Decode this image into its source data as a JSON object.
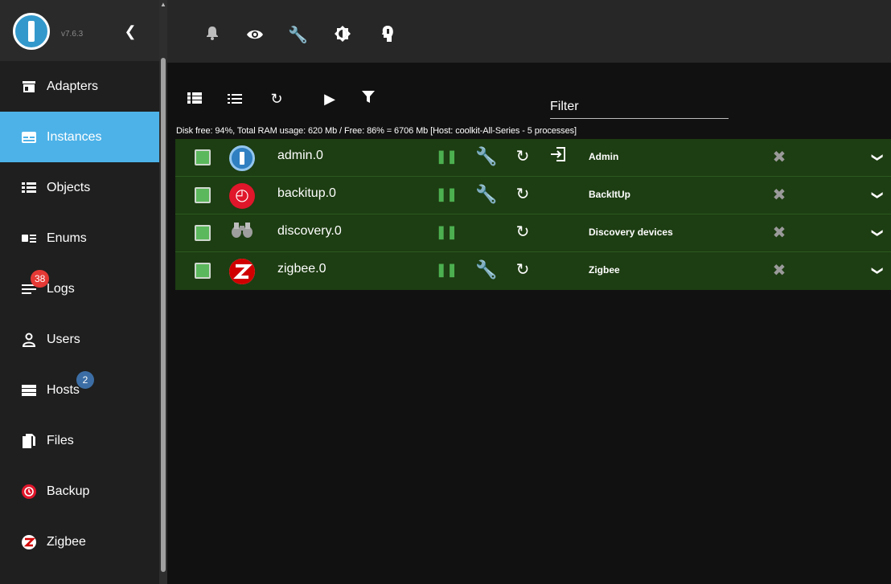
{
  "app": {
    "version": "v7.6.3"
  },
  "sidebar": {
    "items": [
      {
        "label": "Adapters",
        "icon": "store-icon",
        "active": false
      },
      {
        "label": "Instances",
        "icon": "instances-icon",
        "active": true
      },
      {
        "label": "Objects",
        "icon": "list-icon",
        "active": false
      },
      {
        "label": "Enums",
        "icon": "enums-icon",
        "active": false
      },
      {
        "label": "Logs",
        "icon": "logs-icon",
        "active": false,
        "badge": "38"
      },
      {
        "label": "Users",
        "icon": "user-icon",
        "active": false
      },
      {
        "label": "Hosts",
        "icon": "hosts-icon",
        "active": false,
        "badge": "2"
      },
      {
        "label": "Files",
        "icon": "files-icon",
        "active": false
      },
      {
        "label": "Backup",
        "icon": "backup-icon",
        "active": false
      },
      {
        "label": "Zigbee",
        "icon": "zigbee-icon",
        "active": false
      }
    ]
  },
  "topbar": {
    "icons": [
      "bell-icon",
      "eye-icon",
      "wrench-icon",
      "theme-icon",
      "expert-mode-icon"
    ]
  },
  "toolbar": {
    "icons": [
      "view-detailed-icon",
      "view-compact-icon",
      "reload-icon",
      "play-icon",
      "filter-icon"
    ],
    "filter_placeholder": "Filter"
  },
  "status": {
    "text": "Disk free: 94%, Total RAM usage: 620 Mb / Free: 86% = 6706 Mb [Host: coolkit-All-Series - 5 processes]"
  },
  "instances": [
    {
      "name": "admin.0",
      "title": "Admin",
      "has_settings": true,
      "has_link": true
    },
    {
      "name": "backitup.0",
      "title": "BackItUp",
      "has_settings": true,
      "has_link": false
    },
    {
      "name": "discovery.0",
      "title": "Discovery devices",
      "has_settings": false,
      "has_link": false
    },
    {
      "name": "zigbee.0",
      "title": "Zigbee",
      "has_settings": true,
      "has_link": false
    }
  ],
  "colors": {
    "active_nav": "#4db2e8",
    "row_bg": "#1d3d12",
    "running_green": "#4caf50",
    "badge_red": "#e53935",
    "badge_blue": "#3c6ea5"
  }
}
